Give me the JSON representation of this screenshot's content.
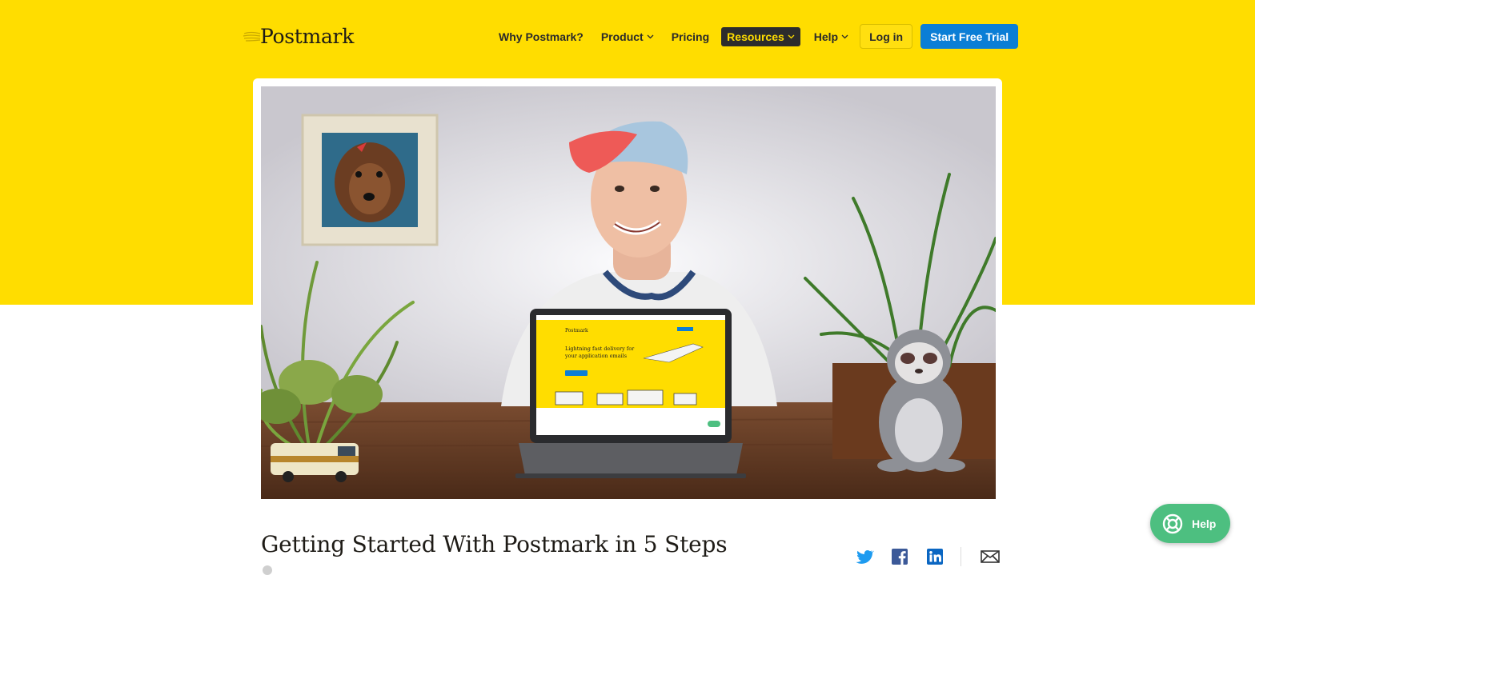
{
  "header": {
    "logo_text": "Postmark",
    "nav": [
      {
        "label": "Why Postmark?"
      },
      {
        "label": "Product"
      },
      {
        "label": "Pricing"
      },
      {
        "label": "Resources"
      },
      {
        "label": "Help"
      }
    ],
    "login_label": "Log in",
    "cta_label": "Start Free Trial"
  },
  "video": {
    "laptop_screen": {
      "logo": "Postmark",
      "headline_line1": "Lightning fast delivery for",
      "headline_line2": "your application emails"
    }
  },
  "post": {
    "title": "Getting Started With Postmark in 5 Steps"
  },
  "share": {
    "icons": [
      "twitter-icon",
      "facebook-icon",
      "linkedin-icon",
      "email-icon"
    ]
  },
  "help_widget": {
    "label": "Help"
  },
  "colors": {
    "brand_yellow": "#ffdd00",
    "cta_blue": "#0b7ed6",
    "help_green": "#4dbf80",
    "nav_active_bg": "#2c2c2c"
  }
}
